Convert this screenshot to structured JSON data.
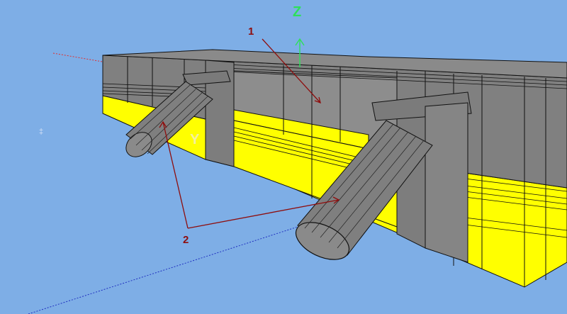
{
  "viewport": {
    "axis_labels": {
      "z": "Z",
      "y": "Y"
    },
    "callouts": [
      "1",
      "2"
    ],
    "cursor_hint": "‡"
  },
  "colors": {
    "background": "#7eaee6",
    "body_gray": "#808080",
    "body_yellow": "#ffff00",
    "edge_line": "#111111",
    "callout_red": "#8e0d0d",
    "axis_green": "#2ee05a",
    "axis_red": "#e03030",
    "axis_blue": "#2030c0"
  }
}
